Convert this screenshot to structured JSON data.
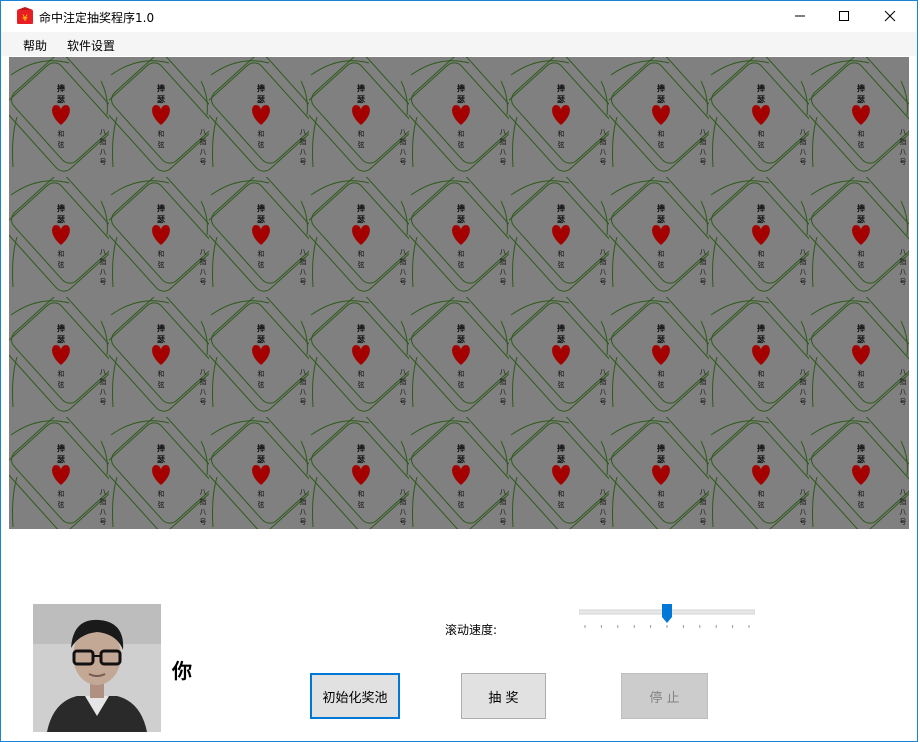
{
  "window": {
    "title": "命中注定抽奖程序1.0",
    "controls": {
      "minimize": "—",
      "maximize": "☐",
      "close": "✕"
    }
  },
  "menu": {
    "items": [
      "帮助",
      "软件设置"
    ]
  },
  "cards": {
    "rows": 4,
    "cols": 9,
    "top_text": "捧瑟",
    "middle_text": "和弦",
    "side_text": "八指八号",
    "heart_color": "#a50000",
    "line_color": "#2d5a1a"
  },
  "controls": {
    "speed_label": "滚动速度:",
    "speed_value": 0.5,
    "init_button": "初始化奖池",
    "draw_button": "抽 奖",
    "stop_button": "停 止"
  },
  "user": {
    "name": "你"
  }
}
